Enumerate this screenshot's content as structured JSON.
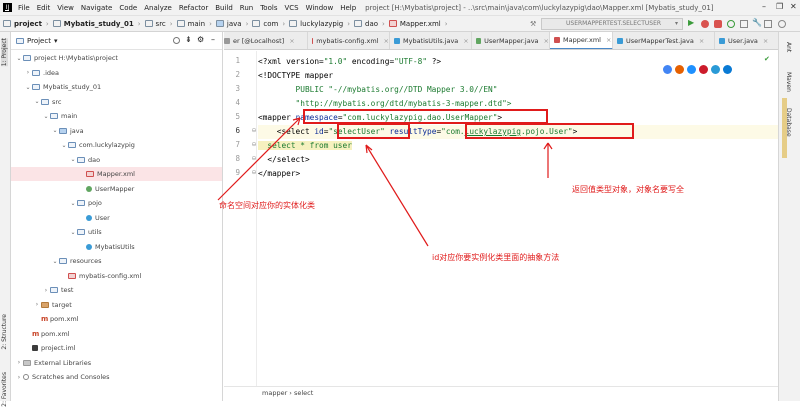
{
  "window": {
    "menu": [
      "File",
      "Edit",
      "View",
      "Navigate",
      "Code",
      "Analyze",
      "Refactor",
      "Build",
      "Run",
      "Tools",
      "VCS",
      "Window",
      "Help"
    ],
    "title": "project [H:\\Mybatis\\project] - ..\\src\\main\\java\\com\\luckylazypig\\dao\\Mapper.xml [Mybatis_study_01]"
  },
  "navbar": {
    "crumbs": [
      "project",
      "Mybatis_study_01",
      "src",
      "main",
      "java",
      "com",
      "luckylazypig",
      "dao",
      "Mapper.xml"
    ],
    "run_config": "USERMAPPERTEST.SELECTUSER"
  },
  "left_strip": {
    "project_tab": "1: Project",
    "structure_tab": "2: Structure",
    "favorites_tab": "2: Favorites"
  },
  "project_panel": {
    "title": "Project",
    "tree": [
      {
        "label": "project  H:\\Mybatis\\project",
        "indent": 0,
        "arrow": "v",
        "icon": "folder"
      },
      {
        "label": ".idea",
        "indent": 1,
        "arrow": ">",
        "icon": "folder"
      },
      {
        "label": "Mybatis_study_01",
        "indent": 1,
        "arrow": "v",
        "icon": "folder"
      },
      {
        "label": "src",
        "indent": 2,
        "arrow": "v",
        "icon": "folder"
      },
      {
        "label": "main",
        "indent": 3,
        "arrow": "v",
        "icon": "folder"
      },
      {
        "label": "java",
        "indent": 4,
        "arrow": "v",
        "icon": "folder-blue"
      },
      {
        "label": "com.luckylazypig",
        "indent": 5,
        "arrow": "v",
        "icon": "folder"
      },
      {
        "label": "dao",
        "indent": 6,
        "arrow": "v",
        "icon": "folder"
      },
      {
        "label": "Mapper.xml",
        "indent": 7,
        "arrow": "",
        "icon": "xml",
        "selected": true
      },
      {
        "label": "UserMapper",
        "indent": 7,
        "arrow": "",
        "icon": "gear"
      },
      {
        "label": "pojo",
        "indent": 6,
        "arrow": "v",
        "icon": "folder"
      },
      {
        "label": "User",
        "indent": 7,
        "arrow": "",
        "icon": "java"
      },
      {
        "label": "utils",
        "indent": 6,
        "arrow": "v",
        "icon": "folder"
      },
      {
        "label": "MybatisUtils",
        "indent": 7,
        "arrow": "",
        "icon": "java"
      },
      {
        "label": "resources",
        "indent": 4,
        "arrow": "v",
        "icon": "folder"
      },
      {
        "label": "mybatis-config.xml",
        "indent": 5,
        "arrow": "",
        "icon": "xml"
      },
      {
        "label": "test",
        "indent": 3,
        "arrow": ">",
        "icon": "folder"
      },
      {
        "label": "target",
        "indent": 2,
        "arrow": ">",
        "icon": "folder-brown"
      },
      {
        "label": "pom.xml",
        "indent": 2,
        "arrow": "",
        "icon": "mvn"
      },
      {
        "label": "pom.xml",
        "indent": 1,
        "arrow": "",
        "icon": "mvn"
      },
      {
        "label": "project.iml",
        "indent": 1,
        "arrow": "",
        "icon": "iml"
      },
      {
        "label": "External Libraries",
        "indent": 0,
        "arrow": ">",
        "icon": "lib"
      },
      {
        "label": "Scratches and Consoles",
        "indent": 0,
        "arrow": ">",
        "icon": "scr"
      }
    ]
  },
  "tabs": [
    {
      "label": "er [@Localhost]",
      "color": "#999",
      "active": false
    },
    {
      "label": "mybatis-config.xml",
      "color": "#d05050",
      "active": false
    },
    {
      "label": "MybatisUtils.java",
      "color": "#3a9bd6",
      "active": false
    },
    {
      "label": "UserMapper.java",
      "color": "#61a661",
      "active": false
    },
    {
      "label": "Mapper.xml",
      "color": "#d05050",
      "active": true
    },
    {
      "label": "UserMapperTest.java",
      "color": "#3a9bd6",
      "active": false
    },
    {
      "label": "User.java",
      "color": "#3a9bd6",
      "active": false
    }
  ],
  "code": {
    "line_numbers": [
      "1",
      "2",
      "3",
      "4",
      "5",
      "6",
      "7",
      "8",
      "9"
    ],
    "l1": {
      "a": "<?xml version=",
      "b": "\"1.0\"",
      "c": " encoding=",
      "d": "\"UTF-8\"",
      "e": " ?>"
    },
    "l2": "<!DOCTYPE mapper",
    "l3": "        PUBLIC \"-//mybatis.org//DTD Mapper 3.0//EN\"",
    "l4": "        \"http://mybatis.org/dtd/mybatis-3-mapper.dtd\">",
    "l5": {
      "a": "<mapper ",
      "b": "namespace",
      "c": "=",
      "d": "\"com.luckylazypig.dao.UserMapper\"",
      "e": ">"
    },
    "l6": {
      "a": "    <select ",
      "b": "id",
      "c": "=",
      "d": "\"selectUser\"",
      "e": " ",
      "f": "resultType",
      "g": "=",
      "h": "\"com.",
      "i": "luckylazypig",
      "j": ".pojo.User\"",
      "k": ">"
    },
    "l7": "  select * from user",
    "l8": "  </select>",
    "l9": "</mapper>"
  },
  "breadcrumb_bar": "mapper  ›  select",
  "right_strip": {
    "ant": "Ant",
    "maven": "Maven",
    "database": "Database"
  },
  "annotations": {
    "namespace": "命名空间对应你的实体化类",
    "id": "id对应你要实例化类里面的抽象方法",
    "result_type": "返回值类型对象，对象名要写全"
  }
}
